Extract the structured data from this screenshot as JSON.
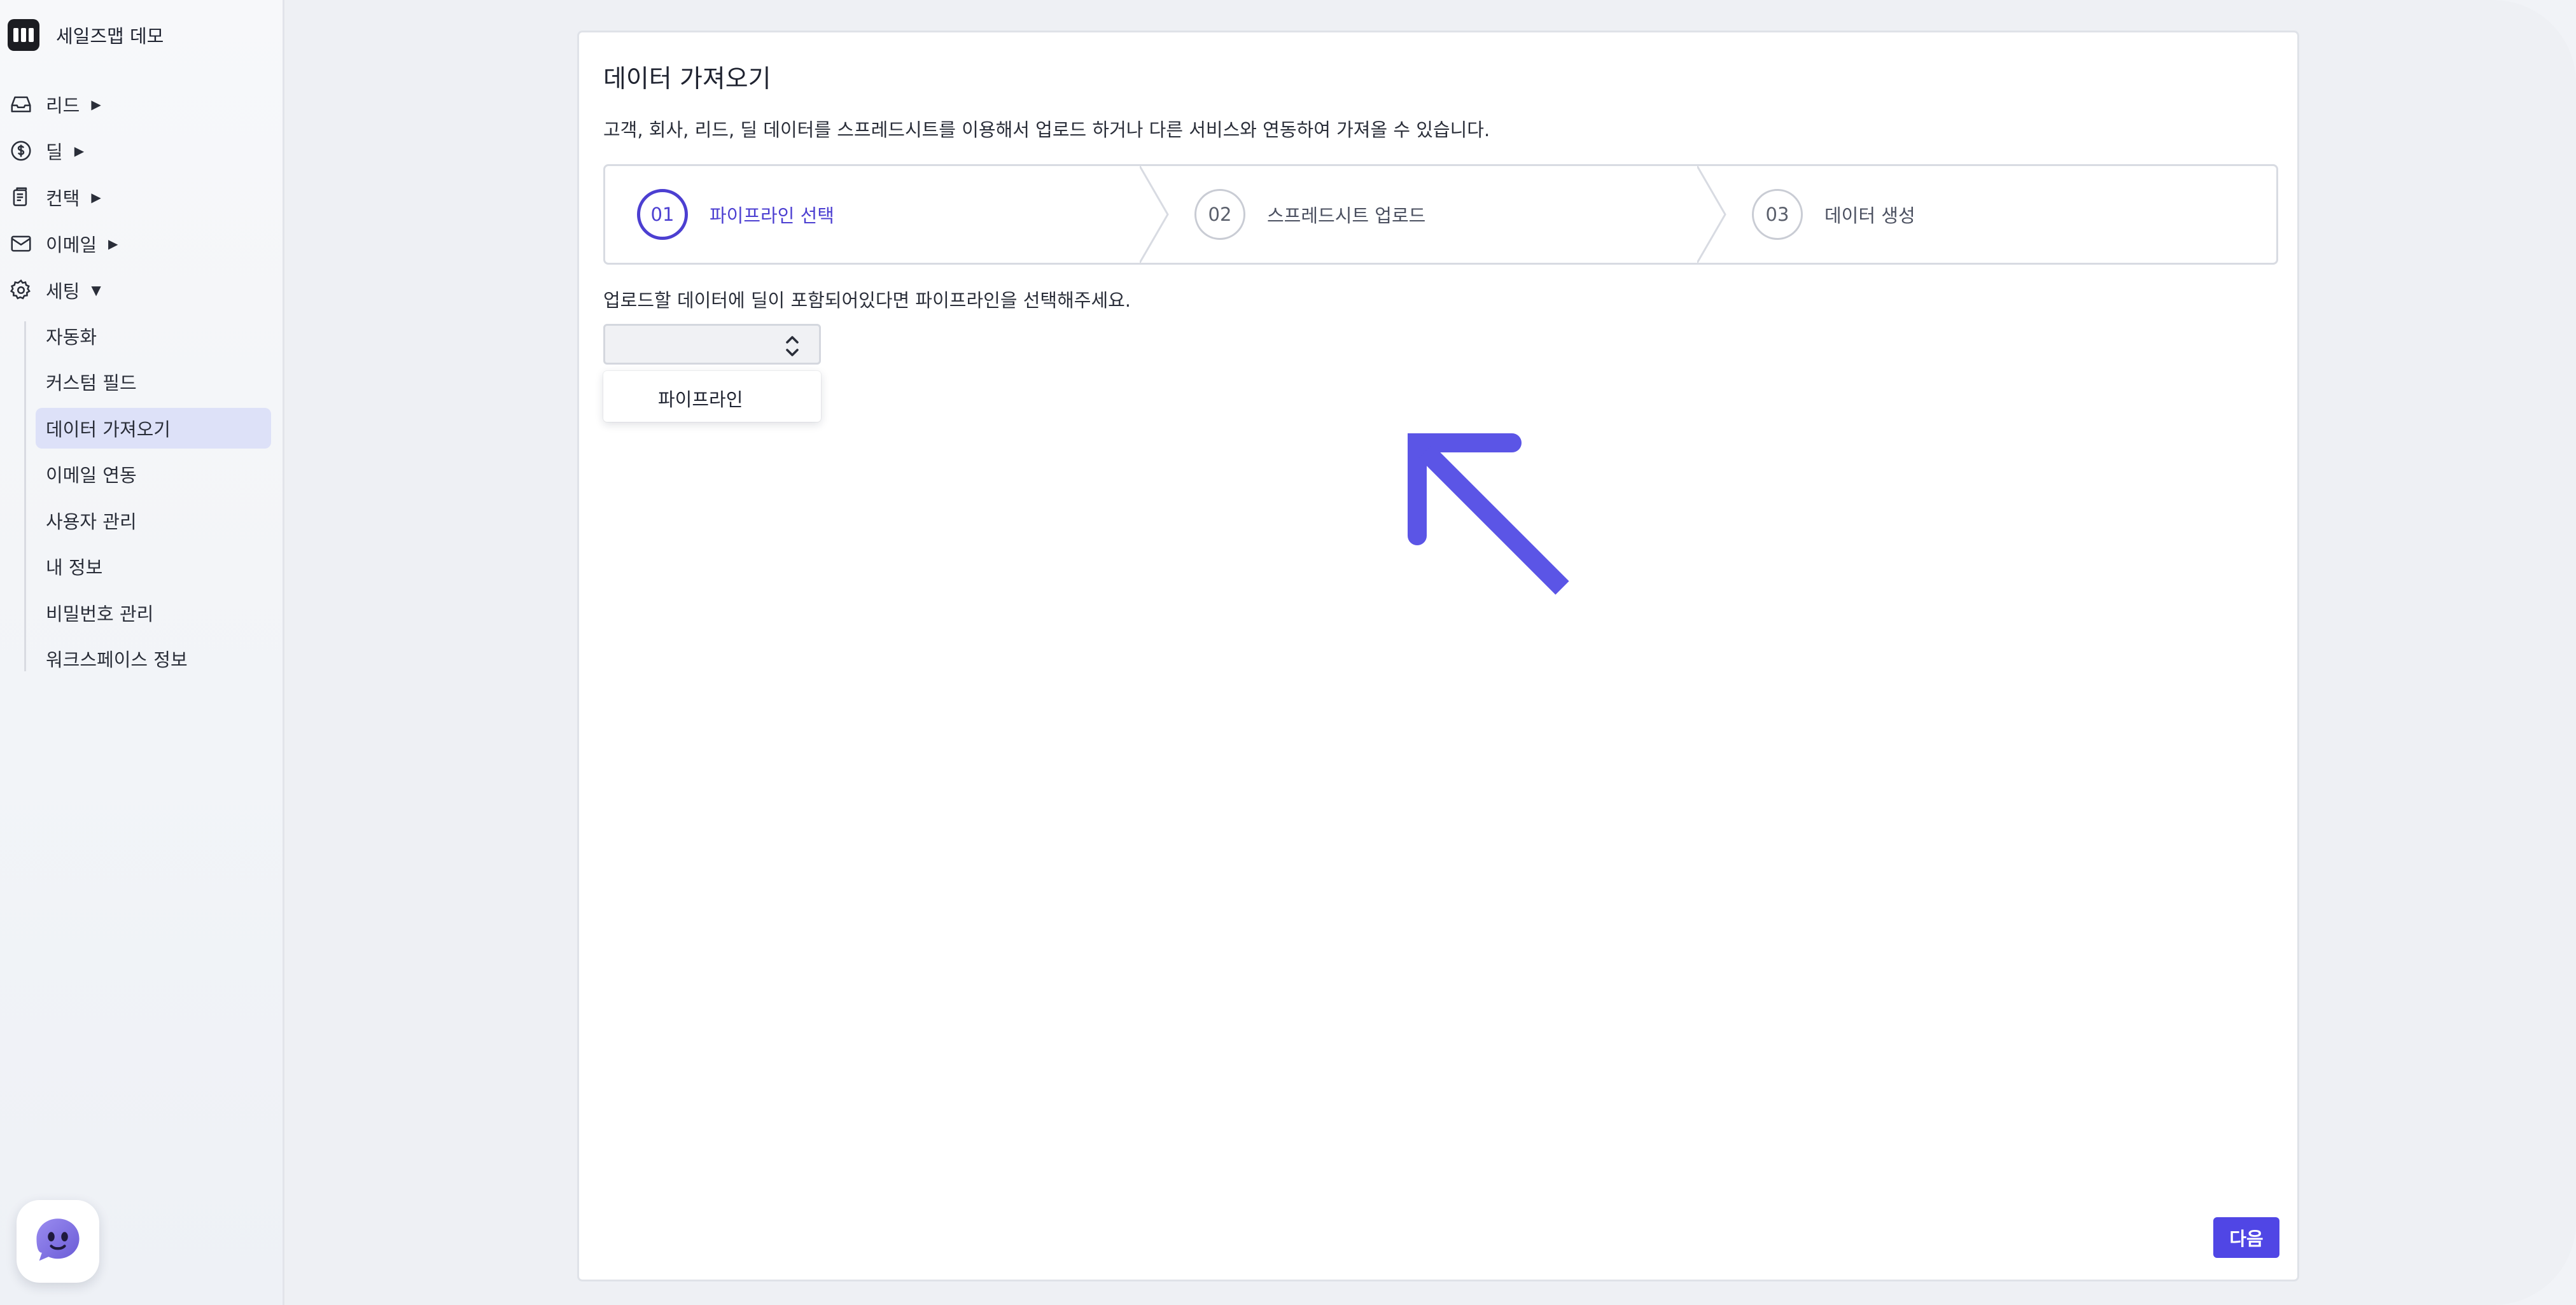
{
  "brand": {
    "name": "세일즈맵 데모"
  },
  "nav": {
    "items": [
      {
        "label": "리드",
        "arrow": "▶"
      },
      {
        "label": "딜",
        "arrow": "▶"
      },
      {
        "label": "컨택",
        "arrow": "▶"
      },
      {
        "label": "이메일",
        "arrow": "▶"
      },
      {
        "label": "세팅",
        "arrow": "▼"
      }
    ],
    "settings_items": [
      "자동화",
      "커스텀 필드",
      "데이터 가져오기",
      "이메일 연동",
      "사용자 관리",
      "내 정보",
      "비밀번호 관리",
      "워크스페이스 정보"
    ]
  },
  "main": {
    "title": "데이터 가져오기",
    "description": "고객, 회사, 리드, 딜 데이터를 스프레드시트를 이용해서 업로드 하거나 다른 서비스와 연동하여 가져올 수 있습니다.",
    "steps": [
      {
        "number": "01",
        "label": "파이프라인 선택"
      },
      {
        "number": "02",
        "label": "스프레드시트 업로드"
      },
      {
        "number": "03",
        "label": "데이터 생성"
      }
    ],
    "instruction": "업로드할 데이터에 딜이 포함되어있다면 파이프라인을 선택해주세요.",
    "select": {
      "value": "",
      "option": "파이프라인"
    },
    "next_label": "다음"
  },
  "colors": {
    "accent": "#5046e5",
    "active_step": "#4c3fd1",
    "annotation_arrow": "#5b55e6"
  }
}
